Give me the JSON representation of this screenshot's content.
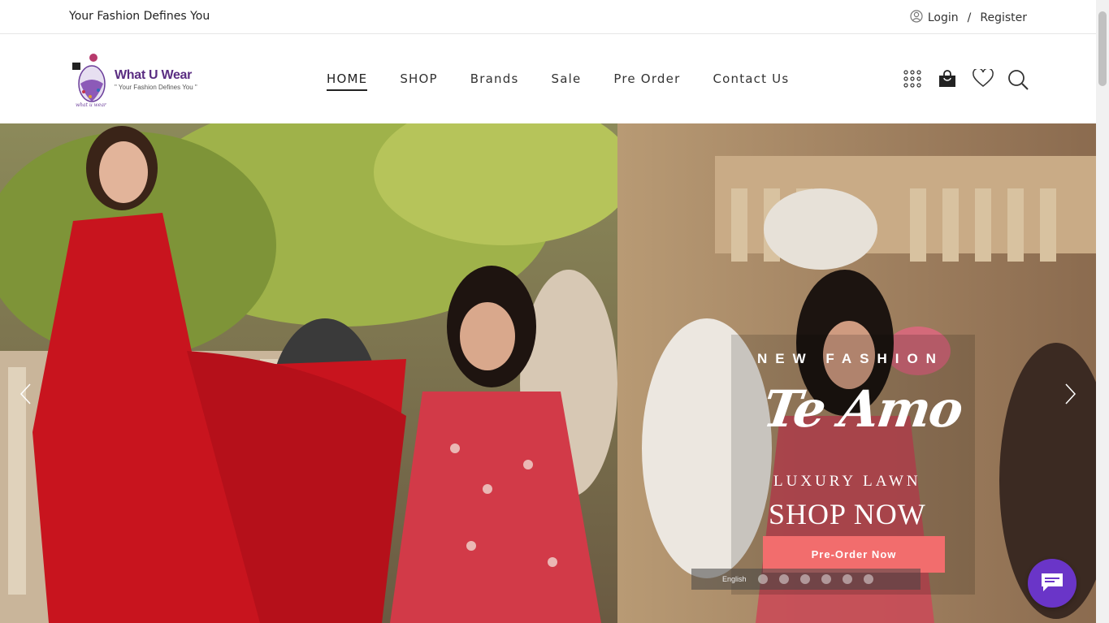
{
  "topbar": {
    "tagline": "Your Fashion Defines You",
    "login_label": "Login",
    "separator": "/",
    "register_label": "Register"
  },
  "logo": {
    "name": "What U Wear",
    "slogan": "\" Your Fashion Defines You \""
  },
  "nav": {
    "items": [
      {
        "label": "HOME",
        "active": true
      },
      {
        "label": "SHOP"
      },
      {
        "label": "Brands"
      },
      {
        "label": "Sale"
      },
      {
        "label": "Pre Order"
      },
      {
        "label": "Contact Us"
      }
    ]
  },
  "header_icons": [
    "grid-menu-icon",
    "shopping-bag-icon",
    "heart-icon",
    "search-icon"
  ],
  "hero": {
    "subtitle": "NEW FASHION",
    "brand": "Te Amo",
    "line": "LUXURY LAWN",
    "cta_text": "SHOP NOW",
    "button_label": "Pre-Order Now",
    "button_color": "#f26d6d"
  },
  "language_bar": {
    "selected": "English"
  },
  "colors": {
    "brand_purple": "#5a2d82",
    "chat_purple": "#6a35c8"
  }
}
